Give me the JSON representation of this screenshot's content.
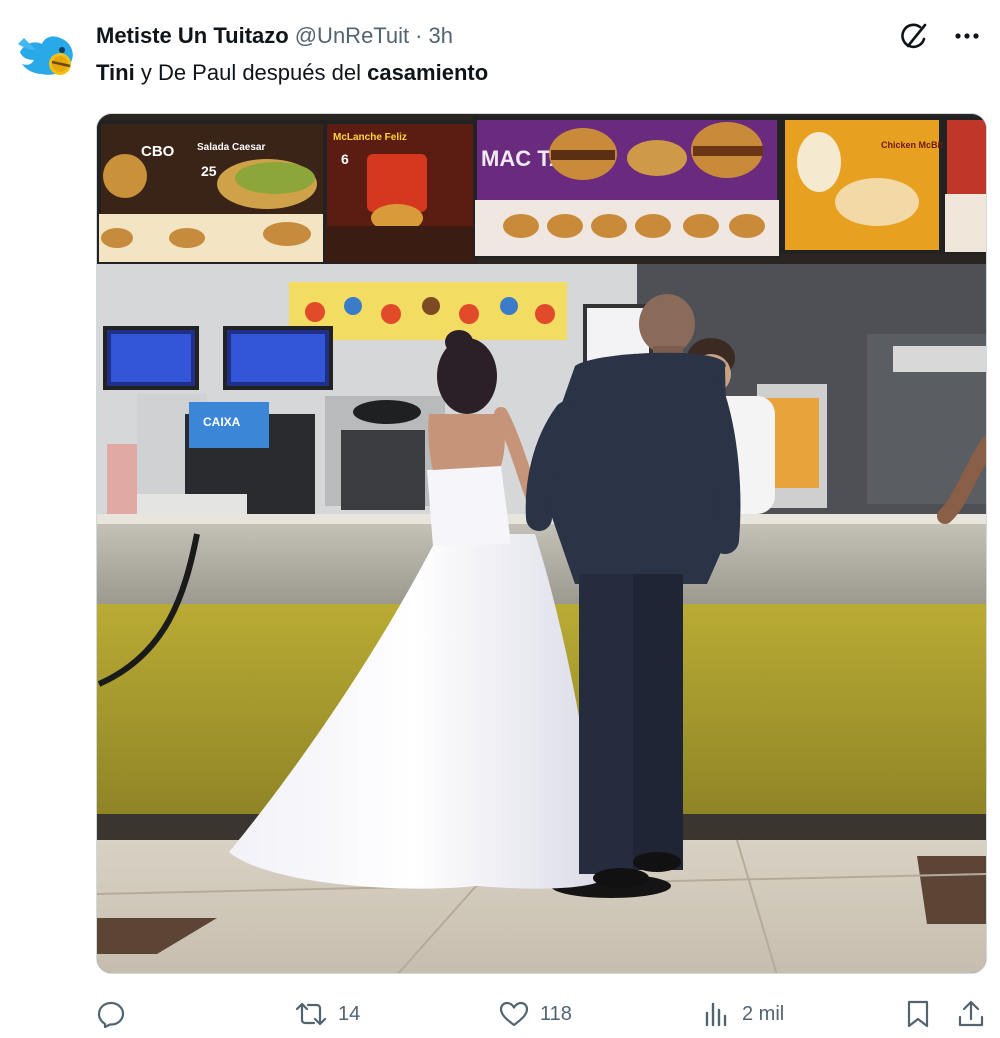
{
  "author": {
    "display_name": "Metiste Un Tuitazo",
    "handle": "@UnReTuit",
    "separator": "·",
    "time": "3h",
    "avatar_icon": "blue-bird-avatar-icon"
  },
  "tweet": {
    "segments": [
      {
        "text": "Tini",
        "bold": true
      },
      {
        "text": " y De Paul después del ",
        "bold": false
      },
      {
        "text": "casamiento",
        "bold": true
      }
    ]
  },
  "header_actions": {
    "grok_icon": "grok-icon",
    "more_icon": "more-options-icon"
  },
  "media": {
    "signs": {
      "cbo": "CBO",
      "salad": "Salada Caesar",
      "salad_price": "25",
      "mclanche": "McLanche Feliz",
      "mclanche_price": "6",
      "mac_tasty": "MAC TASTY",
      "chicken": "Chicken McBites",
      "caixa": "CAIXA"
    }
  },
  "actions": {
    "reply": {
      "icon": "reply-icon",
      "count": ""
    },
    "retweet": {
      "icon": "retweet-icon",
      "count": "14"
    },
    "like": {
      "icon": "heart-icon",
      "count": "118"
    },
    "views": {
      "icon": "views-chart-icon",
      "count": "2 mil"
    },
    "bookmark": {
      "icon": "bookmark-icon"
    },
    "share": {
      "icon": "share-icon"
    }
  },
  "colors": {
    "text_primary": "#0f1419",
    "text_secondary": "#536471",
    "bird_blue": "#1d9bf0"
  }
}
